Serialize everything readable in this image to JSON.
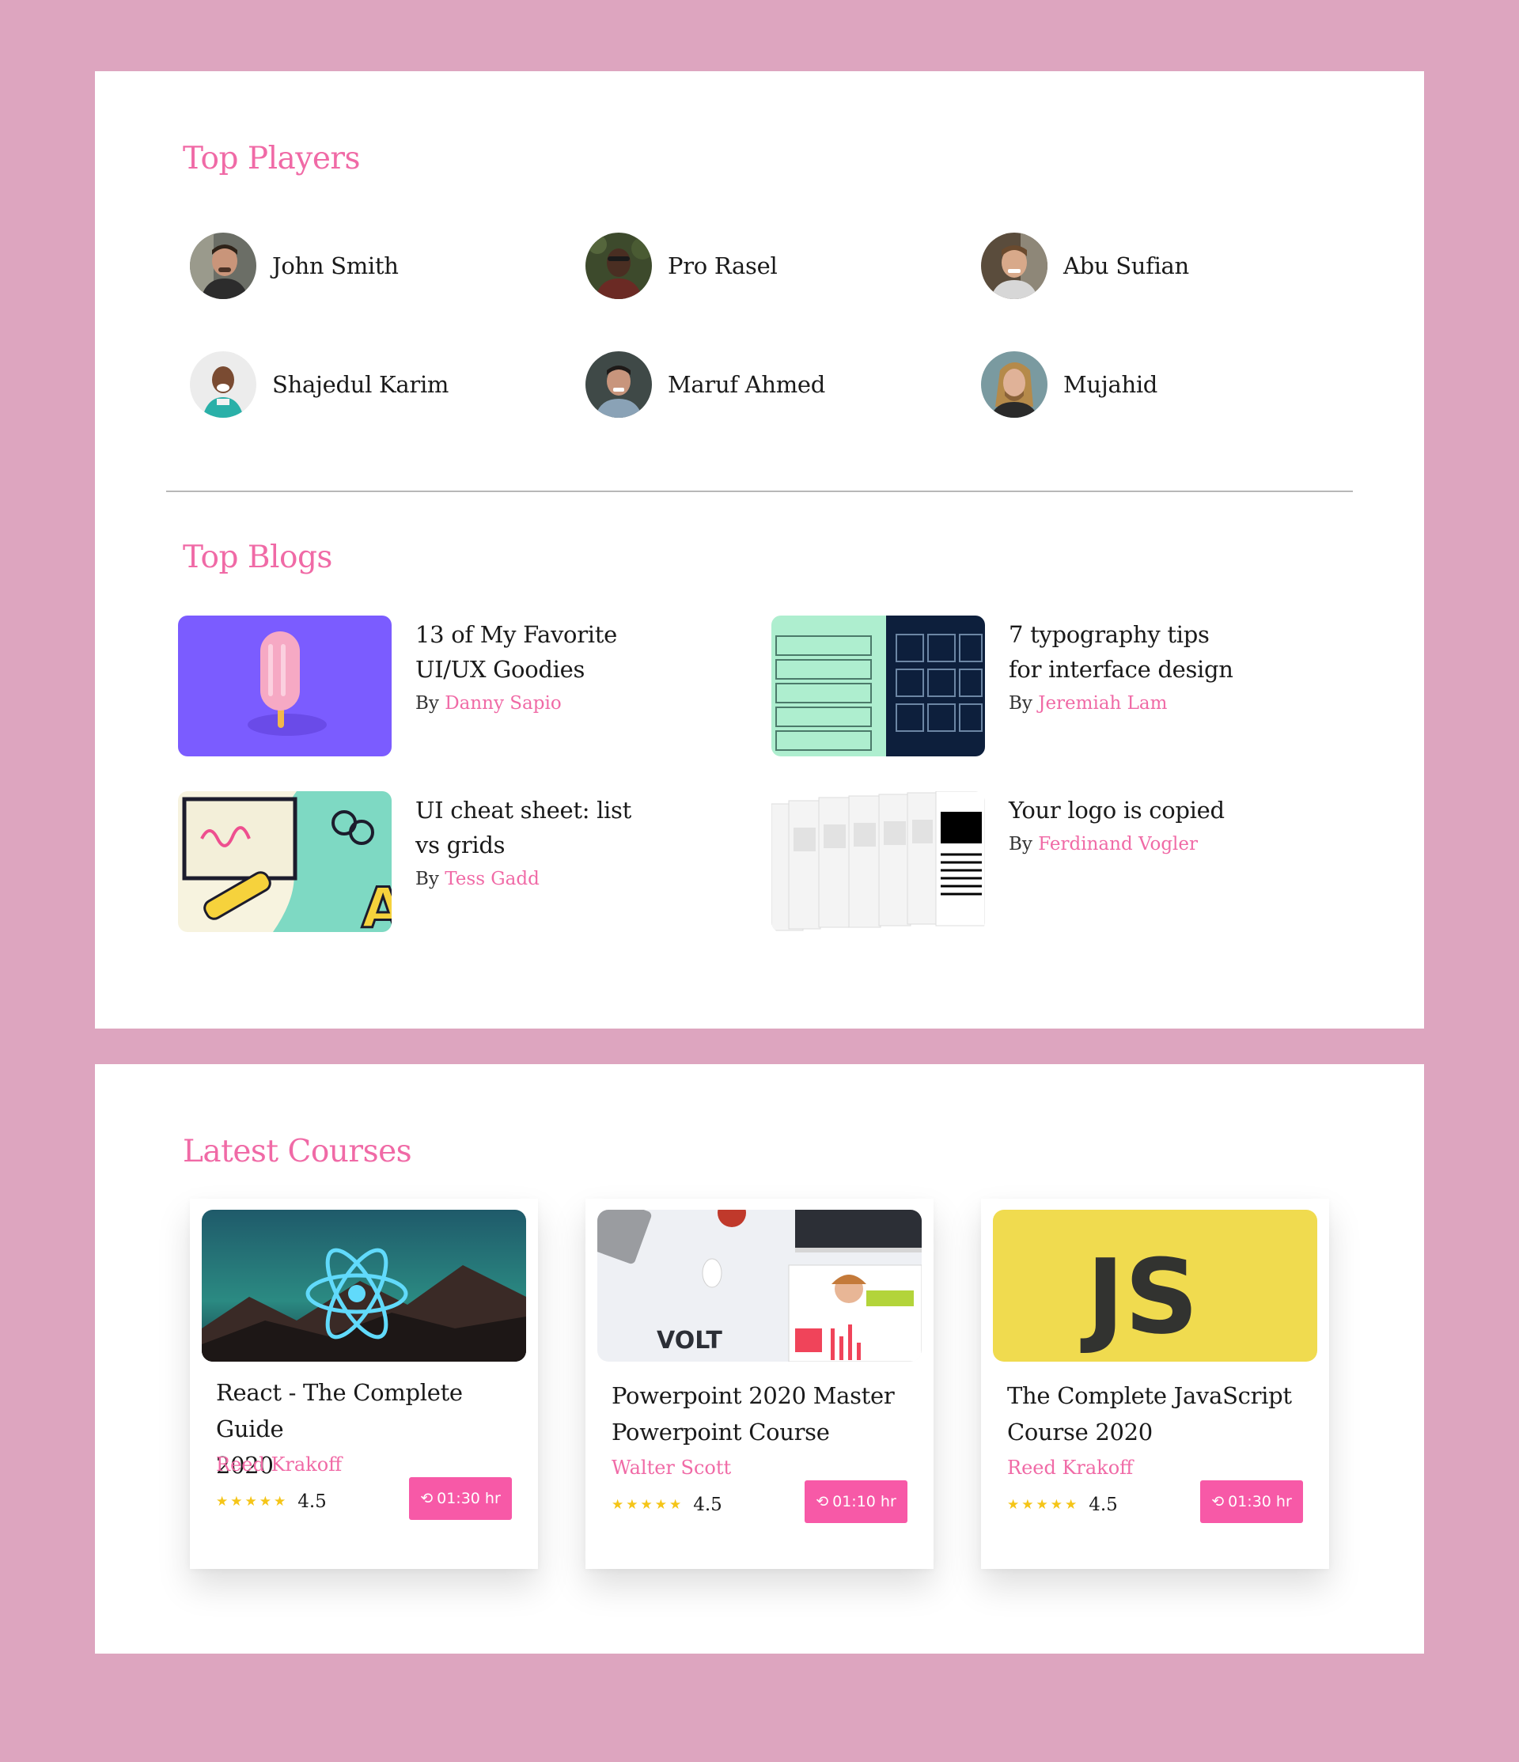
{
  "colors": {
    "background": "#dda5bf",
    "accent": "#f06aa6",
    "button": "#f759a7",
    "star": "#f5c518"
  },
  "players": {
    "title": "Top Players",
    "items": [
      {
        "name": "John Smith"
      },
      {
        "name": "Pro Rasel"
      },
      {
        "name": "Abu Sufian"
      },
      {
        "name": "Shajedul Karim"
      },
      {
        "name": "Maruf Ahmed"
      },
      {
        "name": "Mujahid"
      }
    ]
  },
  "blogs": {
    "title": "Top Blogs",
    "by_label": "By",
    "items": [
      {
        "title_line1": "13 of My Favorite",
        "title_line2": "UI/UX Goodies",
        "author": "Danny Sapio"
      },
      {
        "title_line1": "7 typography tips",
        "title_line2": "for interface design",
        "author": "Jeremiah Lam"
      },
      {
        "title_line1": "UI cheat sheet: list",
        "title_line2": "vs grids",
        "author": "Tess Gadd"
      },
      {
        "title_line1": "Your logo is copied",
        "title_line2": "",
        "author": "Ferdinand Vogler"
      }
    ]
  },
  "courses": {
    "title": "Latest Courses",
    "items": [
      {
        "title_line1": "React - The Complete Guide",
        "title_line2": "2020",
        "instructor": "Reed Krakoff",
        "stars": "★★★★★",
        "rating": "4.5",
        "duration": "01:30 hr",
        "thumb_text": ""
      },
      {
        "title_line1": "Powerpoint 2020 Master",
        "title_line2": "Powerpoint Course",
        "instructor": "Walter Scott",
        "stars": "★★★★★",
        "rating": "4.5",
        "duration": "01:10 hr",
        "thumb_text": "VOLT"
      },
      {
        "title_line1": "The Complete JavaScript",
        "title_line2": "Course 2020",
        "instructor": "Reed Krakoff",
        "stars": "★★★★★",
        "rating": "4.5",
        "duration": "01:30 hr",
        "thumb_text": "JS"
      }
    ]
  },
  "icons": {
    "duration": "clock-history-icon",
    "rating": "star-icon"
  }
}
